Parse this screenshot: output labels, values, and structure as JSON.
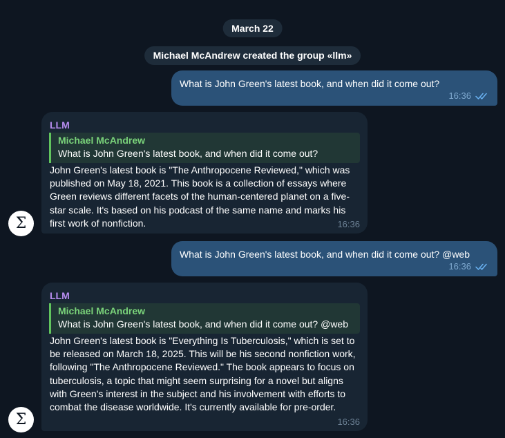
{
  "date_label": "March 22",
  "service_message": "Michael McAndrew created the group «llm»",
  "messages": [
    {
      "text": "What is John Green's latest book, and when did it come out?",
      "time": "16:36"
    },
    {
      "sender": "LLM",
      "reply_to": {
        "name": "Michael McAndrew",
        "text": "What is John Green's latest book, and when did it come out?"
      },
      "text": "John Green's latest book is \"The Anthropocene Reviewed,\" which was published on May 18, 2021. This book is a collection of essays where Green reviews different facets of the human-centered planet on a five-star scale. It's based on his podcast of the same name and marks his first work of nonfiction.",
      "time": "16:36",
      "avatar_symbol": "Σ"
    },
    {
      "text": "What is John Green's latest book, and when did it come out? @web",
      "time": "16:36"
    },
    {
      "sender": "LLM",
      "reply_to": {
        "name": "Michael McAndrew",
        "text": "What is John Green's latest book, and when did it come out? @web"
      },
      "text": "John Green's latest book is \"Everything Is Tuberculosis,\" which is set to be released on March 18, 2025. This will be his second nonfiction work, following \"The Anthropocene Reviewed.\" The book appears to focus on tuberculosis, a topic that might seem surprising for a novel but aligns with Green's interest in the subject and his involvement with efforts to combat the disease worldwide. It's currently available for pre-order.",
      "time": "16:36",
      "avatar_symbol": "Σ"
    }
  ],
  "colors": {
    "background": "#0e1621",
    "outgoing_bubble": "#2b5278",
    "incoming_bubble": "#182533",
    "sender_name": "#b78df0",
    "reply_name": "#7ad37a",
    "reply_accent": "#61c55e",
    "read_checks": "#6ab3f3"
  },
  "icons": {
    "read_receipt": "double-check-icon",
    "avatar": "sigma-avatar-icon"
  }
}
